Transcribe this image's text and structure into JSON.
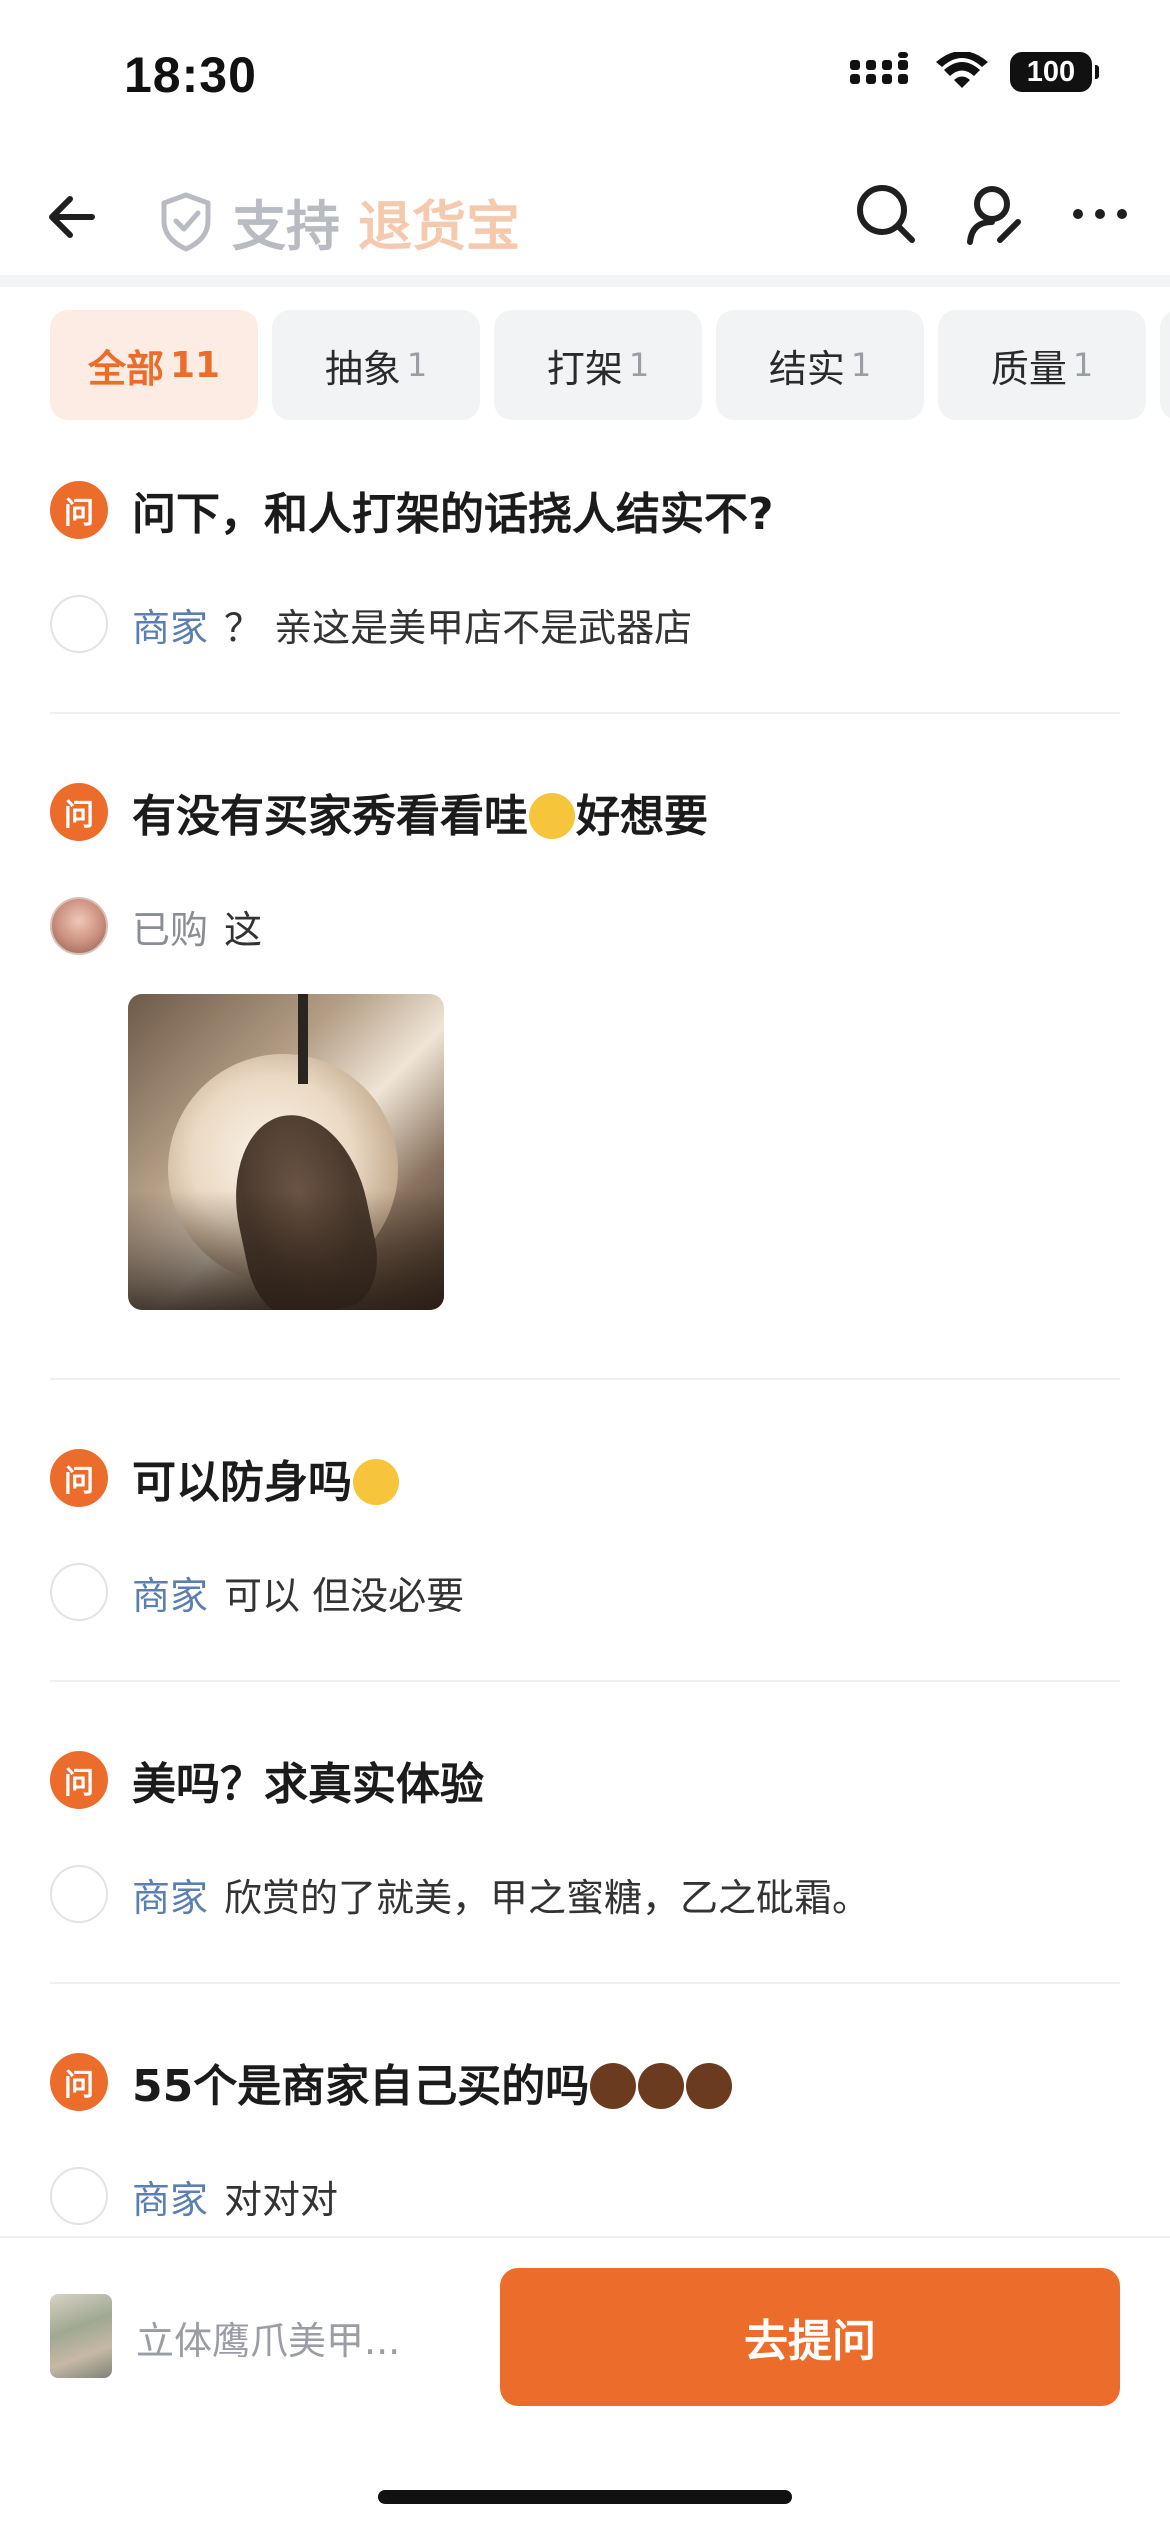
{
  "status_bar": {
    "time": "18:30",
    "battery": "100"
  },
  "nav": {
    "title_support": "支持",
    "title_brand": "退货宝"
  },
  "tabs": [
    {
      "label": "全部",
      "count": "11",
      "active": true
    },
    {
      "label": "抽象",
      "count": "1"
    },
    {
      "label": "打架",
      "count": "1"
    },
    {
      "label": "结实",
      "count": "1"
    },
    {
      "label": "质量",
      "count": "1"
    }
  ],
  "question_badge": "问",
  "qa": [
    {
      "question": "问下，和人打架的话挠人结实不?",
      "answer_role": "商家",
      "answer": "？ 亲这是美甲店不是武器店"
    },
    {
      "question_pre": "有没有买家秀看看哇",
      "question_post": "好想要",
      "answer_role": "已购",
      "answer": "这"
    },
    {
      "question": "可以防身吗",
      "answer_role": "商家",
      "answer": "可以 但没必要"
    },
    {
      "question": "美吗？求真实体验",
      "answer_role": "商家",
      "answer": "欣赏的了就美，甲之蜜糖，乙之砒霜。"
    },
    {
      "question": "55个是商家自己买的吗",
      "answer_role": "商家",
      "answer": "对对对"
    }
  ],
  "bottom": {
    "product_name": "立体鹰爪美甲...",
    "ask_button": "去提问"
  },
  "colors": {
    "accent": "#ec6c2c",
    "role_blue": "#5b7fb3",
    "brand_peach": "#f5c9ad"
  }
}
